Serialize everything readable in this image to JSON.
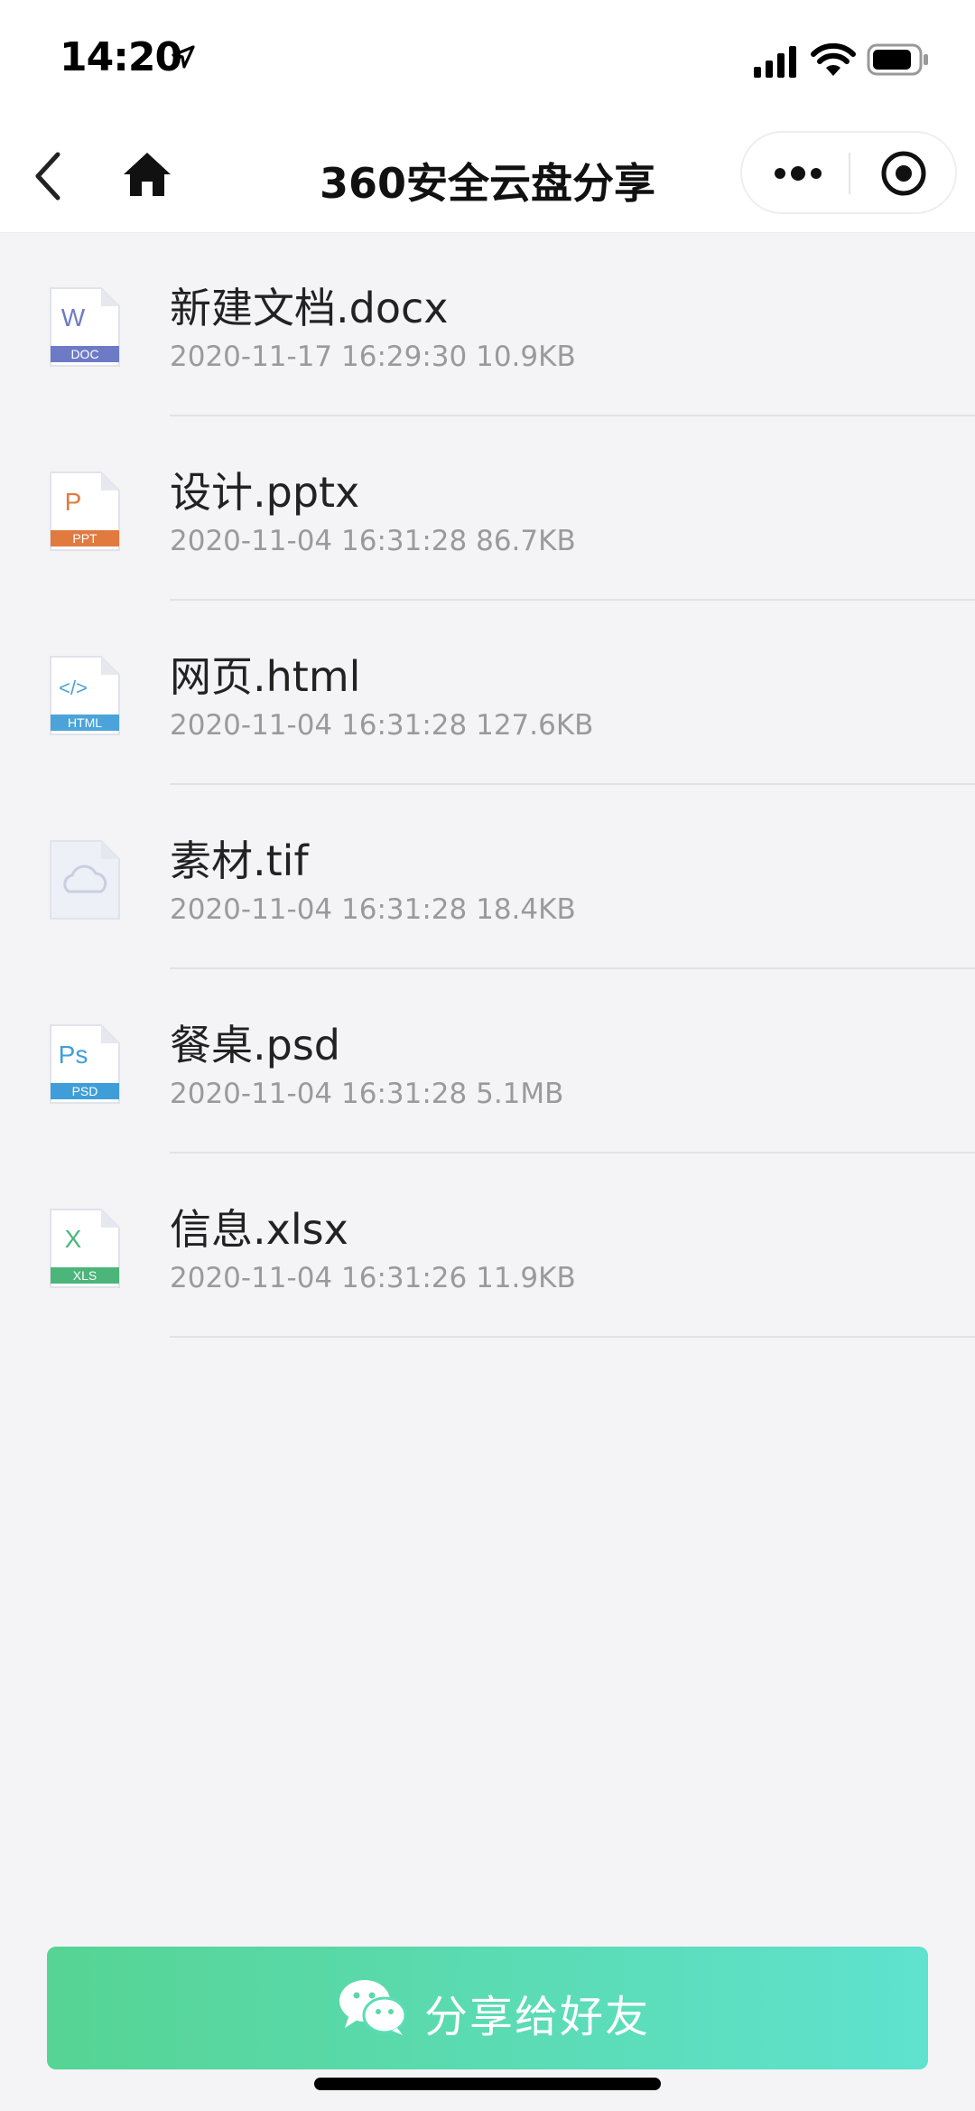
{
  "status_bar": {
    "time": "14:20"
  },
  "nav": {
    "title": "360安全云盘分享"
  },
  "files": [
    {
      "name": "新建文档.docx",
      "meta": "2020-11-17 16:29:30 10.9KB",
      "icon": "doc-file-icon",
      "badge": "DOC",
      "glyph": "W",
      "color": "#6d7bc6"
    },
    {
      "name": "设计.pptx",
      "meta": "2020-11-04 16:31:28 86.7KB",
      "icon": "ppt-file-icon",
      "badge": "PPT",
      "glyph": "P",
      "color": "#e07a3f"
    },
    {
      "name": "网页.html",
      "meta": "2020-11-04 16:31:28 127.6KB",
      "icon": "html-file-icon",
      "badge": "HTML",
      "glyph": "</>",
      "color": "#4ba3d9"
    },
    {
      "name": "素材.tif",
      "meta": "2020-11-04 16:31:28 18.4KB",
      "icon": "generic-file-icon",
      "badge": "",
      "glyph": "",
      "color": "#c9cee0"
    },
    {
      "name": "餐桌.psd",
      "meta": "2020-11-04 16:31:28 5.1MB",
      "icon": "psd-file-icon",
      "badge": "PSD",
      "glyph": "Ps",
      "color": "#3f9ed8"
    },
    {
      "name": "信息.xlsx",
      "meta": "2020-11-04 16:31:26 11.9KB",
      "icon": "xls-file-icon",
      "badge": "XLS",
      "glyph": "X",
      "color": "#4bb57a"
    }
  ],
  "share_button": {
    "label": "分享给好友"
  },
  "colors": {
    "background": "#f4f4f6",
    "share_gradient_start": "#56d494",
    "share_gradient_end": "#5fe2cf"
  }
}
